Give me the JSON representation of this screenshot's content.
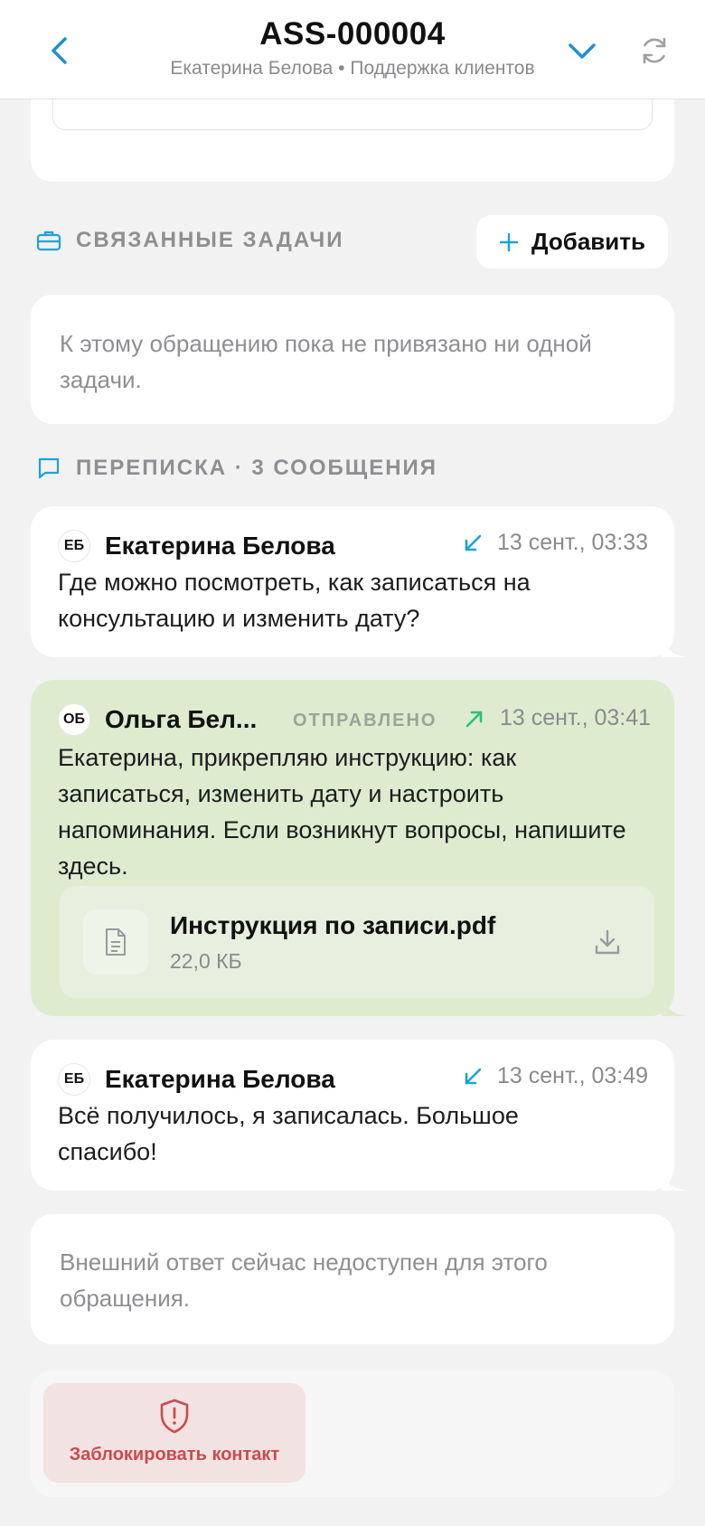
{
  "header": {
    "title": "ASS-000004",
    "subtitle": "Екатерина Белова • Поддержка клиентов"
  },
  "related_tasks": {
    "heading": "СВЯЗАННЫЕ ЗАДАЧИ",
    "add_label": "Добавить",
    "empty_text": "К этому обращению пока не привязано ни одной задачи."
  },
  "correspondence": {
    "heading": "ПЕРЕПИСКА · 3 СООБЩЕНИЯ",
    "messages": [
      {
        "avatar": "ЕБ",
        "sender": "Екатерина Белова",
        "direction": "incoming",
        "time": "13 сент., 03:33",
        "text": "Где можно посмотреть, как записаться на консультацию и изменить дату?"
      },
      {
        "avatar": "ОБ",
        "sender": "Ольга Бел...",
        "status": "ОТПРАВЛЕНО",
        "direction": "outgoing",
        "time": "13 сент., 03:41",
        "text": "Екатерина, прикрепляю инструкцию: как записаться, изменить дату и настроить напоминания. Если возникнут вопросы, напишите здесь.",
        "attachment": {
          "name": "Инструкция по записи.pdf",
          "size": "22,0 КБ"
        }
      },
      {
        "avatar": "ЕБ",
        "sender": "Екатерина Белова",
        "direction": "incoming",
        "time": "13 сент., 03:49",
        "text": "Всё получилось, я записалась. Большое спасибо!"
      }
    ]
  },
  "notice": {
    "text": "Внешний ответ сейчас недоступен для этого обращения."
  },
  "actions": {
    "block_label": "Заблокировать контакт"
  },
  "colors": {
    "accent": "#1e8fd6",
    "incoming_arrow": "#1aa3d9",
    "outgoing_arrow": "#2bbf7a",
    "outgoing_bubble": "#deebcf",
    "danger": "#cc4b4b"
  }
}
